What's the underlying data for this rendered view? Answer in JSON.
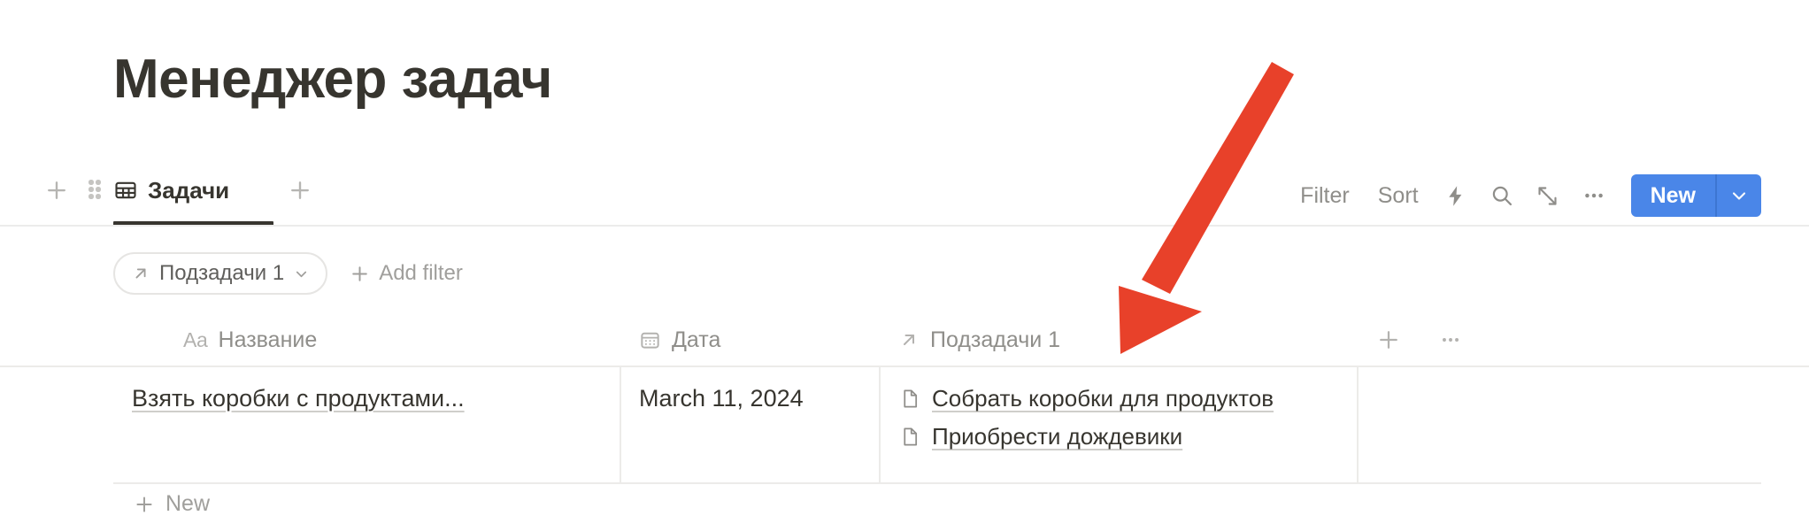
{
  "page": {
    "title": "Менеджер задач"
  },
  "viewbar": {
    "add_view_left_icon": "plus-icon",
    "drag_handle_icon": "drag-dots-icon",
    "tab": {
      "icon": "table-grid-icon",
      "label": "Задачи",
      "active": true
    },
    "add_view_right_icon": "plus-icon",
    "toolbar": {
      "filter_label": "Filter",
      "sort_label": "Sort",
      "automation_icon": "lightning-bolt-icon",
      "search_icon": "search-icon",
      "expand_icon": "expand-arrows-icon",
      "more_icon": "ellipsis-icon",
      "new_label": "New",
      "new_caret_icon": "chevron-down-icon",
      "new_button_color": "#4a86e8"
    }
  },
  "filters": {
    "chip": {
      "icon": "arrow-up-right-icon",
      "label": "Подзадачи 1",
      "caret_icon": "chevron-down-icon"
    },
    "add_filter_label": "Add filter",
    "add_filter_icon": "plus-icon"
  },
  "table": {
    "columns": [
      {
        "type_icon": "text-aa-icon",
        "type_glyph": "Aa",
        "label": "Название"
      },
      {
        "type_icon": "calendar-icon",
        "type_glyph": "",
        "label": "Дата"
      },
      {
        "type_icon": "arrow-up-right-icon",
        "type_glyph": "",
        "label": "Подзадачи 1"
      }
    ],
    "header_add_icon": "plus-icon",
    "header_more_icon": "ellipsis-icon",
    "rows": [
      {
        "name": "Взять коробки с продуктами...",
        "date": "March 11, 2024",
        "relations": [
          {
            "icon": "document-icon",
            "label": "Собрать коробки для продуктов"
          },
          {
            "icon": "document-icon",
            "label": "Приобрести дождевики"
          }
        ]
      }
    ],
    "new_row_label": "New",
    "new_row_icon": "plus-icon"
  },
  "annotation": {
    "arrow_color": "#e8412a",
    "points_at": "Подзадачи 1"
  }
}
